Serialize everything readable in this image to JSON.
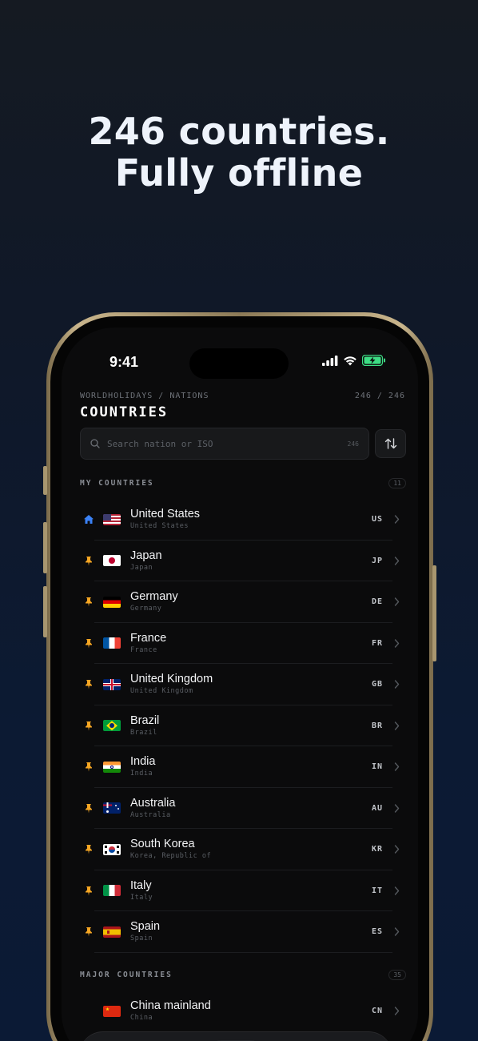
{
  "headline": {
    "line1": "246 countries.",
    "line2": "Fully offline"
  },
  "status_bar": {
    "time": "9:41"
  },
  "header": {
    "breadcrumb": "WORLDHOLIDAYS / NATIONS",
    "counter": "246 / 246",
    "title": "COUNTRIES"
  },
  "search": {
    "placeholder": "Search nation or ISO",
    "count": "246"
  },
  "sections": {
    "my": {
      "label": "MY COUNTRIES",
      "count": "11"
    },
    "major": {
      "label": "MAJOR COUNTRIES",
      "count": "35"
    }
  },
  "my_countries": [
    {
      "lead": "home-icon",
      "name": "United States",
      "sub": "United States",
      "iso": "US",
      "flag": "us"
    },
    {
      "lead": "pin-icon",
      "name": "Japan",
      "sub": "Japan",
      "iso": "JP",
      "flag": "jp"
    },
    {
      "lead": "pin-icon",
      "name": "Germany",
      "sub": "Germany",
      "iso": "DE",
      "flag": "de"
    },
    {
      "lead": "pin-icon",
      "name": "France",
      "sub": "France",
      "iso": "FR",
      "flag": "fr"
    },
    {
      "lead": "pin-icon",
      "name": "United Kingdom",
      "sub": "United Kingdom",
      "iso": "GB",
      "flag": "gb"
    },
    {
      "lead": "pin-icon",
      "name": "Brazil",
      "sub": "Brazil",
      "iso": "BR",
      "flag": "br"
    },
    {
      "lead": "pin-icon",
      "name": "India",
      "sub": "India",
      "iso": "IN",
      "flag": "in"
    },
    {
      "lead": "pin-icon",
      "name": "Australia",
      "sub": "Australia",
      "iso": "AU",
      "flag": "au"
    },
    {
      "lead": "pin-icon",
      "name": "South Korea",
      "sub": "Korea, Republic of",
      "iso": "KR",
      "flag": "kr"
    },
    {
      "lead": "pin-icon",
      "name": "Italy",
      "sub": "Italy",
      "iso": "IT",
      "flag": "it"
    },
    {
      "lead": "pin-icon",
      "name": "Spain",
      "sub": "Spain",
      "iso": "ES",
      "flag": "es"
    }
  ],
  "major_countries": [
    {
      "lead": "",
      "name": "China mainland",
      "sub": "China",
      "iso": "CN",
      "flag": "cn"
    }
  ],
  "tabs": [
    "calendar-icon",
    "globe-icon",
    "list-icon",
    "compare-icon",
    "gear-icon"
  ],
  "colors": {
    "pin": "#f5a623",
    "home": "#3b82f6",
    "active_tab": "#3ddc84"
  }
}
